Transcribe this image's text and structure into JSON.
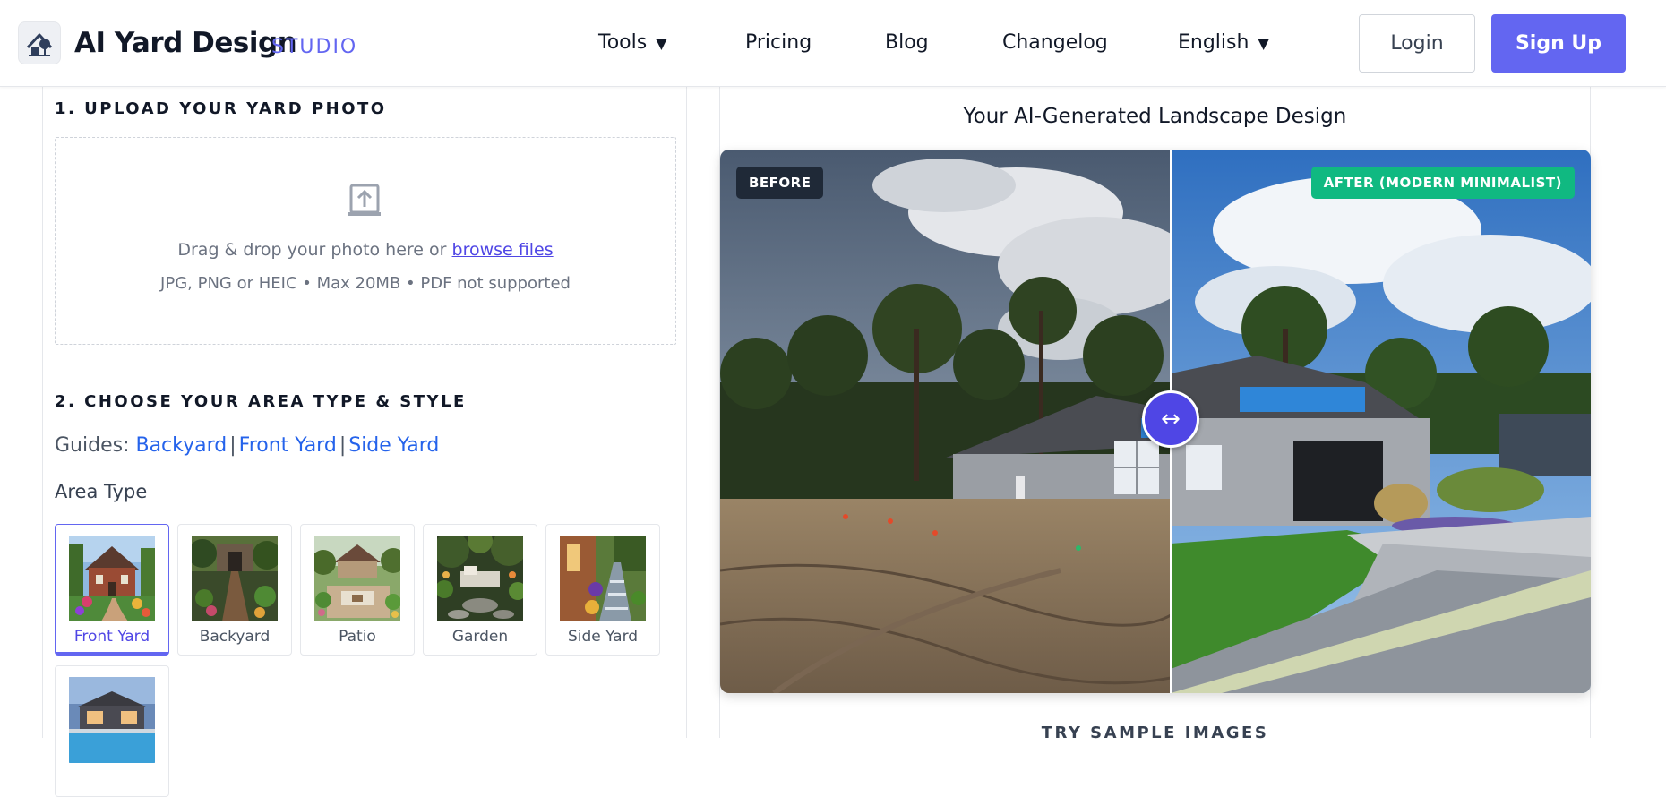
{
  "header": {
    "brand": "AI Yard Design",
    "brand_sub": "STUDIO",
    "nav": {
      "tools": "Tools",
      "pricing": "Pricing",
      "blog": "Blog",
      "changelog": "Changelog",
      "language": "English"
    },
    "login": "Login",
    "signup": "Sign Up"
  },
  "upload": {
    "heading": "1. UPLOAD YOUR YARD PHOTO",
    "drop_text": "Drag & drop your photo here or",
    "browse_link": "browse files",
    "hint": "JPG, PNG or HEIC • Max 20MB • PDF not supported"
  },
  "choose": {
    "heading": "2. CHOOSE YOUR AREA TYPE & STYLE",
    "guides_label": "Guides:",
    "guides": [
      "Backyard",
      "Front Yard",
      "Side Yard"
    ],
    "area_type_label": "Area Type",
    "area_types": [
      {
        "label": "Front Yard",
        "selected": true
      },
      {
        "label": "Backyard",
        "selected": false
      },
      {
        "label": "Patio",
        "selected": false
      },
      {
        "label": "Garden",
        "selected": false
      },
      {
        "label": "Side Yard",
        "selected": false
      },
      {
        "label": "",
        "selected": false
      }
    ]
  },
  "result": {
    "title": "Your AI-Generated Landscape Design",
    "before_badge": "BEFORE",
    "after_badge": "AFTER (MODERN MINIMALIST)",
    "handle_glyph": "↔",
    "try_samples": "TRY SAMPLE IMAGES"
  },
  "colors": {
    "accent": "#6366f1",
    "after_badge": "#10b981",
    "before_badge": "#1f2937",
    "link": "#2563eb"
  }
}
